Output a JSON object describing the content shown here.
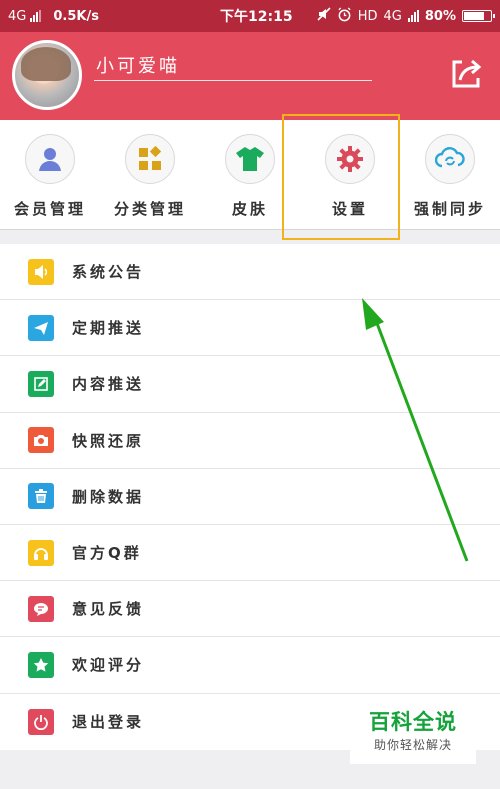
{
  "status_bar": {
    "network": "4G",
    "speed": "0.5K/s",
    "time": "下午12:15",
    "hd": "HD",
    "network2": "4G",
    "battery": "80%"
  },
  "profile": {
    "username": "小可爱喵"
  },
  "tools": [
    {
      "label": "会员管理",
      "icon": "user-icon",
      "color": "#6c7fd8"
    },
    {
      "label": "分类管理",
      "icon": "category-icon",
      "color": "#d8a21b"
    },
    {
      "label": "皮肤",
      "icon": "tshirt-icon",
      "color": "#1bab5c"
    },
    {
      "label": "设置",
      "icon": "gear-icon",
      "color": "#d94a5a"
    },
    {
      "label": "强制同步",
      "icon": "sync-icon",
      "color": "#2aa6d9"
    }
  ],
  "menu": [
    {
      "label": "系统公告",
      "icon": "speaker-icon",
      "color": "#f6c21b"
    },
    {
      "label": "定期推送",
      "icon": "send-icon",
      "color": "#2aa6e0"
    },
    {
      "label": "内容推送",
      "icon": "edit-icon",
      "color": "#1bab5c"
    },
    {
      "label": "快照还原",
      "icon": "camera-icon",
      "color": "#ef5a3a"
    },
    {
      "label": "删除数据",
      "icon": "trash-icon",
      "color": "#2a9fe0"
    },
    {
      "label": "官方Q群",
      "icon": "headset-icon",
      "color": "#f6c21b"
    },
    {
      "label": "意见反馈",
      "icon": "feedback-icon",
      "color": "#e04a5c"
    },
    {
      "label": "欢迎评分",
      "icon": "star-icon",
      "color": "#1bab5c"
    },
    {
      "label": "退出登录",
      "icon": "power-icon",
      "color": "#e04a5c"
    }
  ],
  "watermark": {
    "title": "百科全说",
    "subtitle": "助你轻松解决"
  }
}
